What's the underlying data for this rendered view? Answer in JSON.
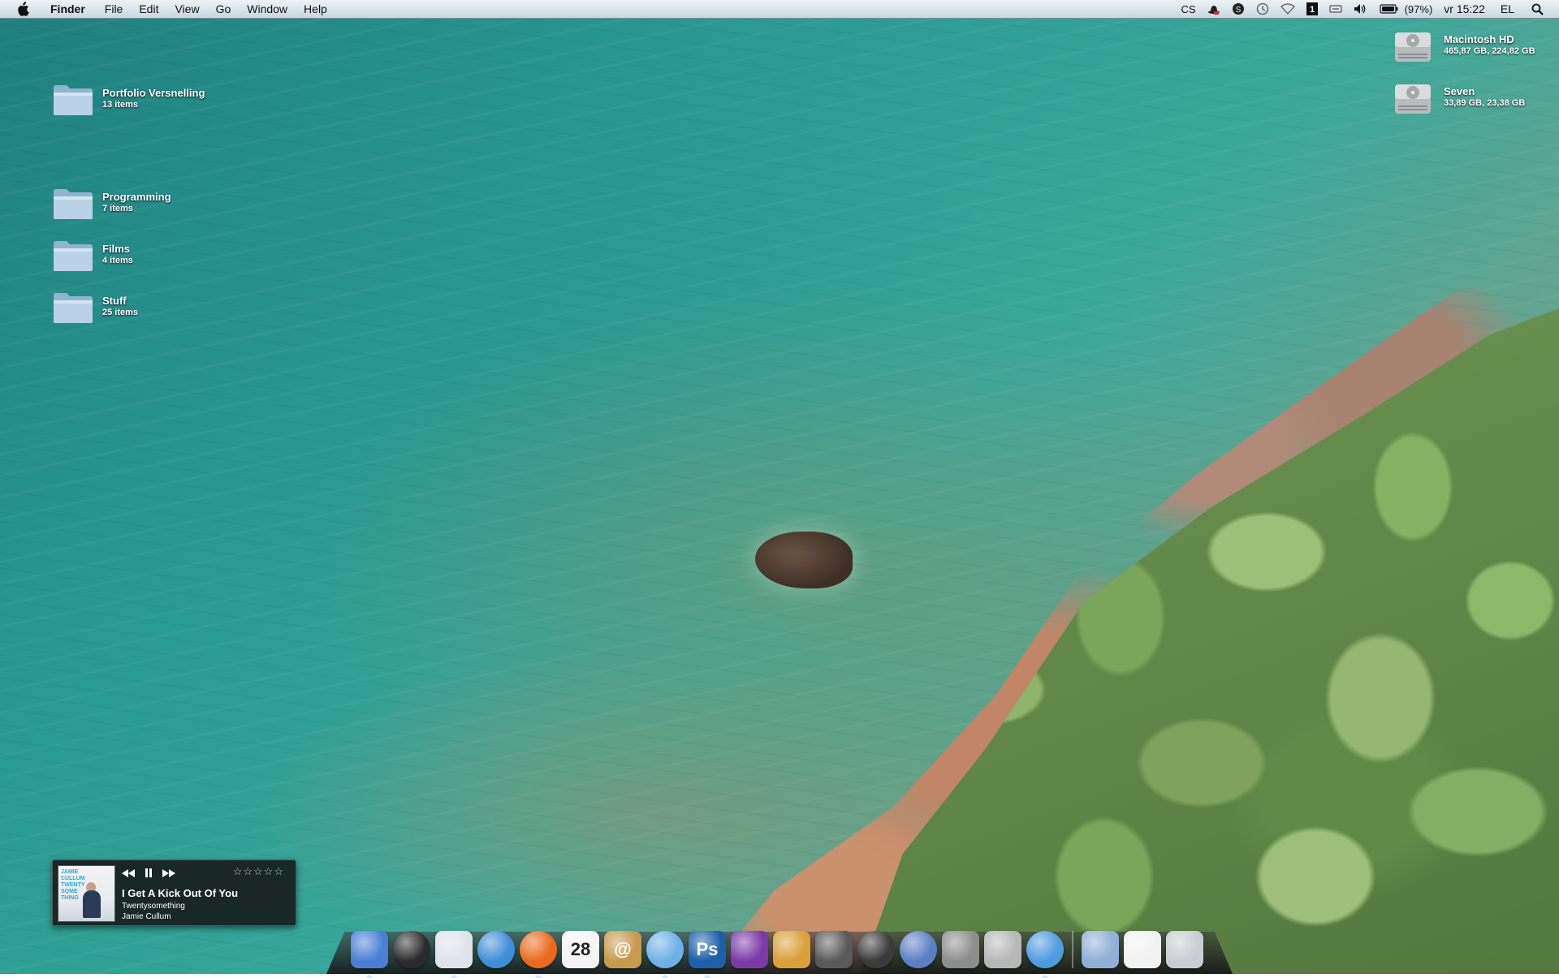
{
  "menubar": {
    "app_name": "Finder",
    "menus": [
      "File",
      "Edit",
      "View",
      "Go",
      "Window",
      "Help"
    ],
    "status": {
      "cs": "CS",
      "battery": "(97%)",
      "clock": "vr 15:22",
      "user": "EL"
    },
    "status_icons": [
      "hat-icon",
      "skype-icon",
      "time-machine-icon",
      "wifi-icon",
      "spaces-icon",
      "keyboard-icon",
      "volume-icon",
      "battery-icon",
      "spotlight-icon"
    ]
  },
  "desktop": {
    "folders": [
      {
        "name": "Portfolio Versnelling",
        "info": "13 items"
      },
      {
        "name": "Programming",
        "info": "7 items"
      },
      {
        "name": "Films",
        "info": "4 items"
      },
      {
        "name": "Stuff",
        "info": "25 items"
      }
    ],
    "drives": [
      {
        "name": "Macintosh HD",
        "info": "465,87 GB, 224,82 GB"
      },
      {
        "name": "Seven",
        "info": "33,89 GB, 23,38 GB"
      }
    ]
  },
  "music_widget": {
    "cover_text": "JAMIE CULLUM TWENTY SOME THING",
    "track": "I Get A Kick Out Of You",
    "album": "Twentysomething",
    "artist": "Jamie Cullum",
    "rating_stars": "☆☆☆☆☆",
    "controls": [
      "previous-icon",
      "pause-icon",
      "next-icon"
    ]
  },
  "dock": {
    "apps": [
      {
        "icon": "finder-icon",
        "color": "#4a7fd4",
        "running": true
      },
      {
        "icon": "dashboard-icon",
        "color": "#2b2b2b",
        "running": false
      },
      {
        "icon": "mail-icon",
        "color": "#dfe4ea",
        "running": true
      },
      {
        "icon": "safari-icon",
        "color": "#3f8fd8",
        "running": false
      },
      {
        "icon": "firefox-icon",
        "color": "#e86a1c",
        "running": true
      },
      {
        "icon": "ical-icon",
        "color": "#f4f4f4",
        "running": false,
        "label": "28"
      },
      {
        "icon": "address-book-icon",
        "color": "#c79a4e",
        "running": false,
        "label": "@"
      },
      {
        "icon": "itunes-icon",
        "color": "#6fb0e6",
        "running": true
      },
      {
        "icon": "photoshop-icon",
        "color": "#1d5fa8",
        "running": true,
        "label": "Ps"
      },
      {
        "icon": "aperture-icon",
        "color": "#7b3aa8",
        "running": false
      },
      {
        "icon": "transmit-icon",
        "color": "#d9a13a",
        "running": false
      },
      {
        "icon": "imovie-icon",
        "color": "#5a5a5a",
        "running": false
      },
      {
        "icon": "dvd-player-icon",
        "color": "#3a3a3a",
        "running": false
      },
      {
        "icon": "color-sync-icon",
        "color": "#5b7fc2",
        "running": false
      },
      {
        "icon": "system-preferences-icon",
        "color": "#8d8d8d",
        "running": false
      },
      {
        "icon": "script-editor-icon",
        "color": "#b8b8b8",
        "running": false
      },
      {
        "icon": "ichat-icon",
        "color": "#4e9be0",
        "running": true
      }
    ],
    "stacks": [
      {
        "icon": "applications-stack-icon",
        "color": "#8fb0d6"
      },
      {
        "icon": "documents-stack-icon",
        "color": "#f2f2f2"
      },
      {
        "icon": "trash-icon",
        "color": "#c9ced3"
      }
    ]
  }
}
